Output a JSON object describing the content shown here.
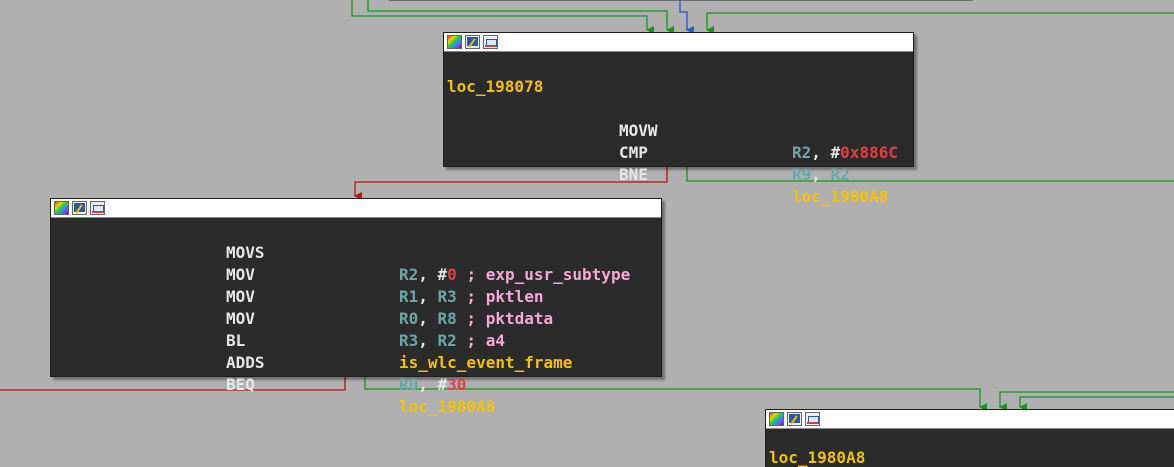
{
  "icons": [
    "color-palette-icon",
    "rename-pencil-icon",
    "graph-overview-icon"
  ],
  "colors": {
    "background": "#b0b0b0",
    "node_bg": "#2b2b2b",
    "label": "#f2c200",
    "mnemonic": "#e6e6e6",
    "register": "#6aa8a8",
    "immediate": "#e04040",
    "comment": "#f7a8d8",
    "edge_true": "#14961e",
    "edge_false": "#b41414",
    "edge_jump": "#1e5ad2"
  },
  "nodes": {
    "n1": {
      "label": "loc_198078",
      "lines": [
        {
          "mnemonic": "MOVW",
          "r1": "R2",
          "sep": ", #",
          "imm": "0x886C"
        },
        {
          "mnemonic": "CMP",
          "r1": "R9",
          "sep": ", ",
          "r2": "R2"
        },
        {
          "mnemonic": "BNE",
          "target": "loc_1980A8"
        }
      ]
    },
    "n2": {
      "lines": [
        {
          "mnemonic": "MOVS",
          "r1": "R2",
          "sep": ", #",
          "imm": "0",
          "comment": " ; exp_usr_subtype"
        },
        {
          "mnemonic": "MOV",
          "r1": "R1",
          "sep": ", ",
          "r2": "R3",
          "comment": " ; pktlen"
        },
        {
          "mnemonic": "MOV",
          "r1": "R0",
          "sep": ", ",
          "r2": "R8",
          "comment": " ; pktdata"
        },
        {
          "mnemonic": "MOV",
          "r1": "R3",
          "sep": ", ",
          "r2": "R2",
          "comment": " ; a4"
        },
        {
          "mnemonic": "BL",
          "target": "is_wlc_event_frame"
        },
        {
          "mnemonic": "ADDS",
          "r1": "R0",
          "sep": ", #",
          "imm": "30"
        },
        {
          "mnemonic": "BEQ",
          "target": "loc_1980A8"
        }
      ]
    },
    "n3": {
      "label": "loc_1980A8"
    }
  }
}
